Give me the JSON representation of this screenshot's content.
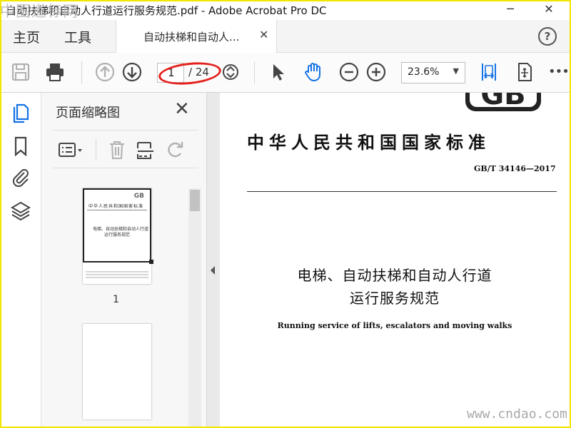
{
  "window": {
    "title": "自动扶梯和自动人行道运行服务规范.pdf - Adobe Acrobat Pro DC",
    "watermark_top": "中国道标网",
    "minimize_label": "─",
    "close_label": "✕"
  },
  "menubar": {
    "home_label": "主页",
    "tools_label": "工具",
    "tab_label": "自动扶梯和自动人...",
    "tab_close": "✕",
    "help_label": "?"
  },
  "toolbar": {
    "page_current": "1",
    "page_total": "/ 24",
    "zoom_value": "23.6%",
    "zoom_caret": "▼",
    "more_label": "•••"
  },
  "thumbnails_panel": {
    "title": "页面缩略图",
    "close_label": "✕",
    "pages": [
      {
        "number": "1"
      }
    ],
    "thumb_gb": "GB",
    "thumb_title": "中华人民共和国国家标准",
    "thumb_name_line1": "电梯、自动扶梯和自动人行道",
    "thumb_name_line2": "运行服务规范"
  },
  "document": {
    "logo": "GB",
    "standard_title": "中华人民共和国国家标准",
    "standard_code": "GB/T 34146—2017",
    "name_line1": "电梯、自动扶梯和自动人行道",
    "name_line2": "运行服务规范",
    "english_name": "Running service of lifts, escalators and moving walks"
  },
  "watermark_bottom": "www.cndao.com",
  "colors": {
    "accent_blue": "#1473e6",
    "annotation_red": "#e3201b",
    "frame_yellow": "#f1e600"
  }
}
